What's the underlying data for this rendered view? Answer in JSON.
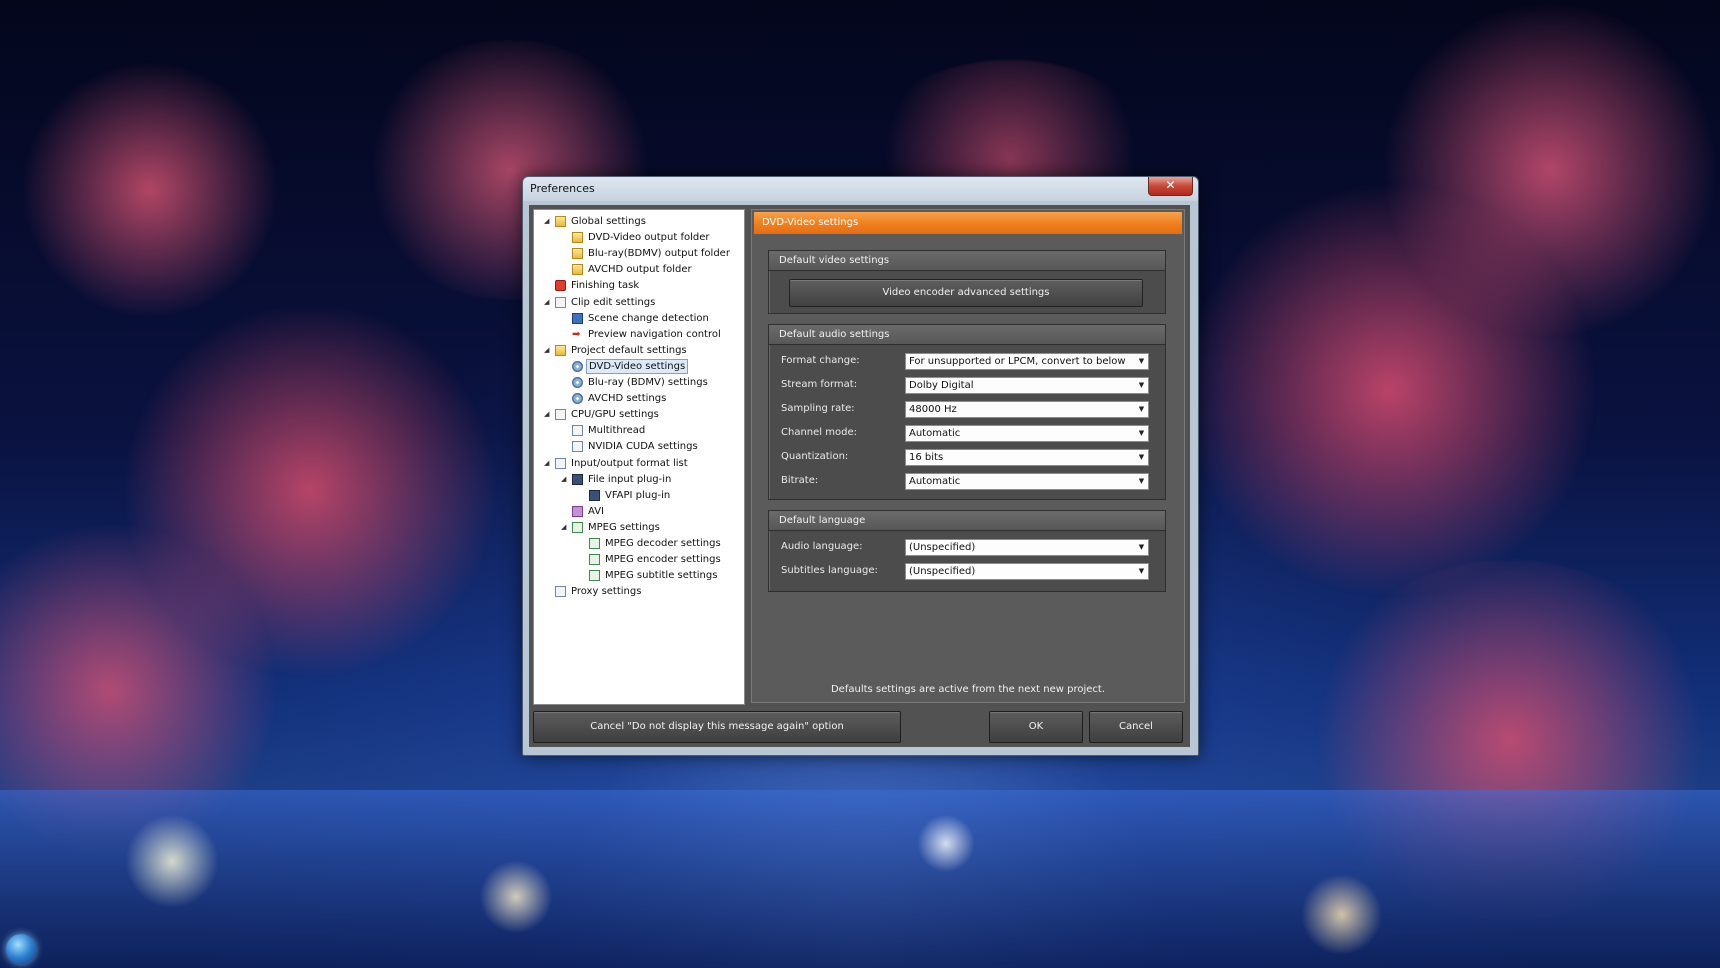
{
  "window": {
    "title": "Preferences",
    "close_glyph": "✕"
  },
  "tree": {
    "items": [
      {
        "label": "Global settings",
        "icon": "folder-icon"
      },
      {
        "label": "DVD-Video output folder",
        "icon": "folder-icon"
      },
      {
        "label": "Blu-ray(BDMV) output folder",
        "icon": "folder-icon"
      },
      {
        "label": "AVCHD output folder",
        "icon": "folder-icon"
      },
      {
        "label": "Finishing task",
        "icon": "task-icon"
      },
      {
        "label": "Clip edit settings",
        "icon": "page-icon"
      },
      {
        "label": "Scene change detection",
        "icon": "scene-icon"
      },
      {
        "label": "Preview navigation control",
        "icon": "arrow-icon"
      },
      {
        "label": "Project default settings",
        "icon": "folder-icon"
      },
      {
        "label": "DVD-Video settings",
        "icon": "disc-icon",
        "selected": true
      },
      {
        "label": "Blu-ray (BDMV) settings",
        "icon": "disc-icon"
      },
      {
        "label": "AVCHD settings",
        "icon": "disc-icon"
      },
      {
        "label": "CPU/GPU settings",
        "icon": "page-icon"
      },
      {
        "label": "Multithread",
        "icon": "page-icon"
      },
      {
        "label": "NVIDIA CUDA settings",
        "icon": "page-icon"
      },
      {
        "label": "Input/output format list",
        "icon": "page-icon"
      },
      {
        "label": "File input plug-in",
        "icon": "monitor-icon"
      },
      {
        "label": "VFAPI plug-in",
        "icon": "monitor-icon"
      },
      {
        "label": "AVI",
        "icon": "avi-icon"
      },
      {
        "label": "MPEG settings",
        "icon": "mpeg-icon"
      },
      {
        "label": "MPEG decoder settings",
        "icon": "mpeg-icon"
      },
      {
        "label": "MPEG encoder settings",
        "icon": "mpeg-icon"
      },
      {
        "label": "MPEG subtitle settings",
        "icon": "mpeg-icon"
      },
      {
        "label": "Proxy settings",
        "icon": "page-icon"
      }
    ]
  },
  "panel": {
    "header": "DVD-Video settings",
    "video_group": {
      "title": "Default video settings",
      "button": "Video encoder advanced settings"
    },
    "audio_group": {
      "title": "Default audio settings",
      "rows": [
        {
          "label": "Format change:",
          "value": "For unsupported or LPCM, convert to below"
        },
        {
          "label": "Stream format:",
          "value": "Dolby Digital"
        },
        {
          "label": "Sampling rate:",
          "value": "48000  Hz"
        },
        {
          "label": "Channel mode:",
          "value": "Automatic"
        },
        {
          "label": "Quantization:",
          "value": "16 bits"
        },
        {
          "label": "Bitrate:",
          "value": "Automatic"
        }
      ]
    },
    "language_group": {
      "title": "Default language",
      "rows": [
        {
          "label": "Audio language:",
          "value": "(Unspecified)"
        },
        {
          "label": "Subtitles language:",
          "value": "(Unspecified)"
        }
      ]
    },
    "note": "Defaults settings are active from the next new project."
  },
  "buttons": {
    "cancel_option": "Cancel \"Do not display this message again\" option",
    "ok": "OK",
    "cancel": "Cancel"
  },
  "colors": {
    "accent_header": "#ef7f1f",
    "panel_bg": "#5b5b5b"
  }
}
